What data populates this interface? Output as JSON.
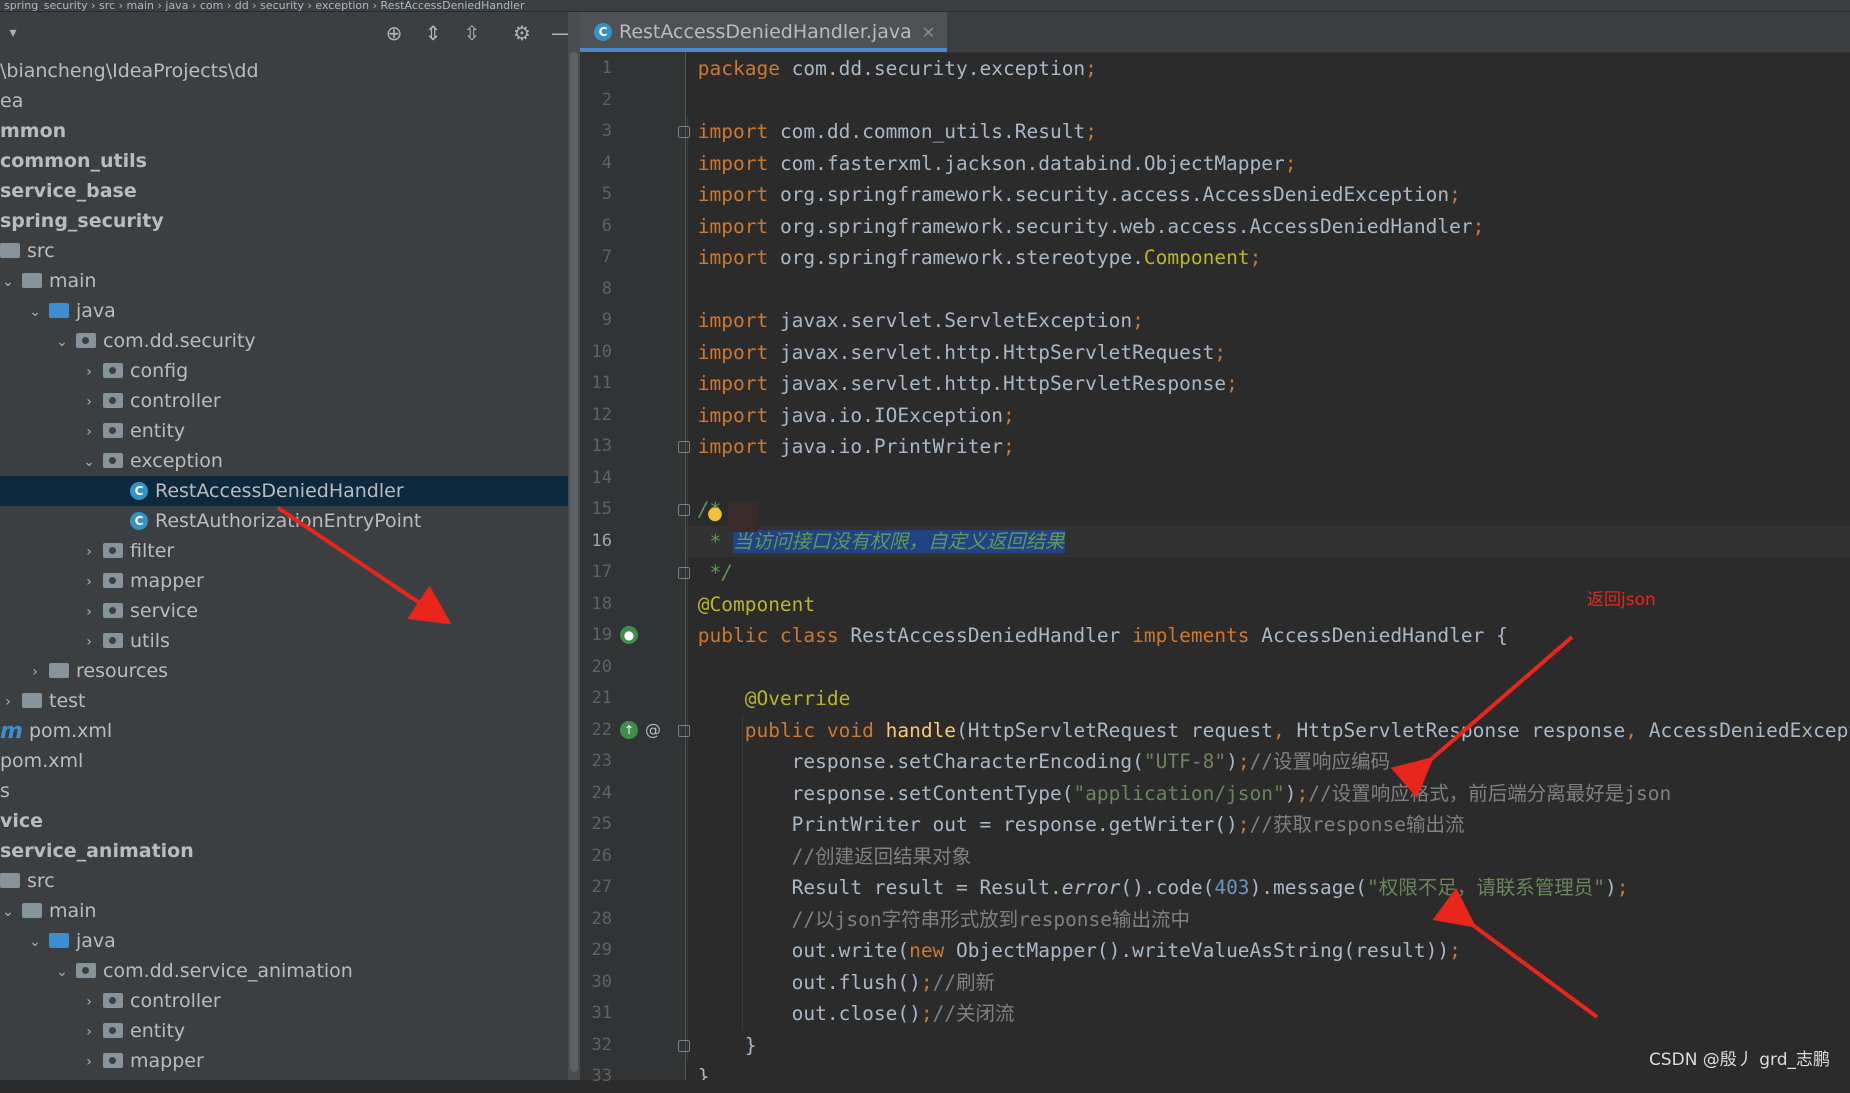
{
  "breadcrumb": "spring_security  ›  src  ›  main  ›  java  ›  com  ›  dd  ›  security  ›  exception  ›  RestAccessDeniedHandler",
  "sidebar": {
    "tree": [
      {
        "label": "\\biancheng\\IdeaProjects\\dd",
        "indent": 0,
        "icon": "none",
        "chev": "none",
        "bold": false,
        "name": "tree-project-path",
        "selected": false
      },
      {
        "label": "ea",
        "indent": 0,
        "icon": "none",
        "chev": "none",
        "bold": false,
        "name": "tree-item-idea",
        "selected": false
      },
      {
        "label": "mmon",
        "indent": 0,
        "icon": "none",
        "chev": "none",
        "bold": true,
        "name": "tree-item-common",
        "selected": false
      },
      {
        "label": "common_utils",
        "indent": 0,
        "icon": "none",
        "chev": "none",
        "bold": true,
        "name": "tree-item-common-utils",
        "selected": false
      },
      {
        "label": "service_base",
        "indent": 0,
        "icon": "none",
        "chev": "none",
        "bold": true,
        "name": "tree-item-service-base",
        "selected": false
      },
      {
        "label": "spring_security",
        "indent": 0,
        "icon": "none",
        "chev": "none",
        "bold": true,
        "name": "tree-item-spring-security",
        "selected": false
      },
      {
        "label": "src",
        "indent": 0,
        "icon": "folder",
        "chev": "none",
        "bold": false,
        "name": "tree-item-src",
        "selected": false
      },
      {
        "label": "main",
        "indent": 1,
        "icon": "folder",
        "chev": "down",
        "bold": false,
        "name": "tree-item-main",
        "selected": false
      },
      {
        "label": "java",
        "indent": 2,
        "icon": "folder-blue",
        "chev": "down",
        "bold": false,
        "name": "tree-item-java",
        "selected": false
      },
      {
        "label": "com.dd.security",
        "indent": 3,
        "icon": "package",
        "chev": "down",
        "bold": false,
        "name": "tree-item-com-dd-security",
        "selected": false
      },
      {
        "label": "config",
        "indent": 4,
        "icon": "package",
        "chev": "right",
        "bold": false,
        "name": "tree-item-config",
        "selected": false
      },
      {
        "label": "controller",
        "indent": 4,
        "icon": "package",
        "chev": "right",
        "bold": false,
        "name": "tree-item-controller",
        "selected": false
      },
      {
        "label": "entity",
        "indent": 4,
        "icon": "package",
        "chev": "right",
        "bold": false,
        "name": "tree-item-entity",
        "selected": false
      },
      {
        "label": "exception",
        "indent": 4,
        "icon": "package",
        "chev": "down",
        "bold": false,
        "name": "tree-item-exception",
        "selected": false
      },
      {
        "label": "RestAccessDeniedHandler",
        "indent": 5,
        "icon": "class",
        "chev": "none",
        "bold": false,
        "name": "tree-item-rest-access-denied-handler",
        "selected": true
      },
      {
        "label": "RestAuthorizationEntryPoint",
        "indent": 5,
        "icon": "class",
        "chev": "none",
        "bold": false,
        "name": "tree-item-rest-authorization-entry-point",
        "selected": false
      },
      {
        "label": "filter",
        "indent": 4,
        "icon": "package",
        "chev": "right",
        "bold": false,
        "name": "tree-item-filter",
        "selected": false
      },
      {
        "label": "mapper",
        "indent": 4,
        "icon": "package",
        "chev": "right",
        "bold": false,
        "name": "tree-item-mapper",
        "selected": false
      },
      {
        "label": "service",
        "indent": 4,
        "icon": "package",
        "chev": "right",
        "bold": false,
        "name": "tree-item-service",
        "selected": false
      },
      {
        "label": "utils",
        "indent": 4,
        "icon": "package",
        "chev": "right",
        "bold": false,
        "name": "tree-item-utils",
        "selected": false
      },
      {
        "label": "resources",
        "indent": 2,
        "icon": "folder",
        "chev": "right",
        "bold": false,
        "name": "tree-item-resources",
        "selected": false
      },
      {
        "label": "test",
        "indent": 1,
        "icon": "folder",
        "chev": "right",
        "bold": false,
        "name": "tree-item-test",
        "selected": false
      },
      {
        "label": "pom.xml",
        "indent": 0,
        "icon": "maven",
        "chev": "none",
        "bold": false,
        "name": "tree-item-pom-xml-module",
        "selected": false
      },
      {
        "label": "pom.xml",
        "indent": 0,
        "icon": "none",
        "chev": "none",
        "bold": false,
        "name": "tree-item-pom-xml",
        "selected": false
      },
      {
        "label": "s",
        "indent": 0,
        "icon": "none",
        "chev": "none",
        "bold": false,
        "name": "tree-item-s",
        "selected": false
      },
      {
        "label": "vice",
        "indent": 0,
        "icon": "none",
        "chev": "none",
        "bold": true,
        "name": "tree-item-service",
        "selected": false
      },
      {
        "label": "service_animation",
        "indent": 0,
        "icon": "none",
        "chev": "none",
        "bold": true,
        "name": "tree-item-service-animation",
        "selected": false
      },
      {
        "label": "src",
        "indent": 0,
        "icon": "folder",
        "chev": "none",
        "bold": false,
        "name": "tree-item-src-2",
        "selected": false
      },
      {
        "label": "main",
        "indent": 1,
        "icon": "folder",
        "chev": "down",
        "bold": false,
        "name": "tree-item-main-2",
        "selected": false
      },
      {
        "label": "java",
        "indent": 2,
        "icon": "folder-blue",
        "chev": "down",
        "bold": false,
        "name": "tree-item-java-2",
        "selected": false
      },
      {
        "label": "com.dd.service_animation",
        "indent": 3,
        "icon": "package",
        "chev": "down",
        "bold": false,
        "name": "tree-item-com-dd-service-animation",
        "selected": false
      },
      {
        "label": "controller",
        "indent": 4,
        "icon": "package",
        "chev": "right",
        "bold": false,
        "name": "tree-item-controller-2",
        "selected": false
      },
      {
        "label": "entity",
        "indent": 4,
        "icon": "package",
        "chev": "right",
        "bold": false,
        "name": "tree-item-entity-2",
        "selected": false
      },
      {
        "label": "mapper",
        "indent": 4,
        "icon": "package",
        "chev": "right",
        "bold": false,
        "name": "tree-item-mapper-2",
        "selected": false
      }
    ]
  },
  "toolbar": {
    "icons": [
      "crosshair-icon",
      "expand-all-icon",
      "collapse-all-icon",
      "gear-icon",
      "minimize-icon"
    ]
  },
  "editor": {
    "tab_label": "RestAccessDeniedHandler.java",
    "current_line": 16,
    "lines": [
      [
        [
          "kw",
          "package "
        ],
        [
          "",
          "com.dd.security.exception"
        ],
        [
          "kw",
          ";"
        ]
      ],
      [],
      [
        [
          "kw",
          "import "
        ],
        [
          "",
          "com.dd.common_utils.Result"
        ],
        [
          "kw",
          ";"
        ]
      ],
      [
        [
          "kw",
          "import "
        ],
        [
          "",
          "com.fasterxml.jackson.databind.ObjectMapper"
        ],
        [
          "kw",
          ";"
        ]
      ],
      [
        [
          "kw",
          "import "
        ],
        [
          "",
          "org.springframework.security.access.AccessDeniedException"
        ],
        [
          "kw",
          ";"
        ]
      ],
      [
        [
          "kw",
          "import "
        ],
        [
          "",
          "org.springframework.security.web.access.AccessDeniedHandler"
        ],
        [
          "kw",
          ";"
        ]
      ],
      [
        [
          "kw",
          "import "
        ],
        [
          "",
          "org.springframework.stereotype."
        ],
        [
          "an",
          "Component"
        ],
        [
          "kw",
          ";"
        ]
      ],
      [],
      [
        [
          "kw",
          "import "
        ],
        [
          "",
          "javax.servlet.ServletException"
        ],
        [
          "kw",
          ";"
        ]
      ],
      [
        [
          "kw",
          "import "
        ],
        [
          "",
          "javax.servlet.http.HttpServletRequest"
        ],
        [
          "kw",
          ";"
        ]
      ],
      [
        [
          "kw",
          "import "
        ],
        [
          "",
          "javax.servlet.http.HttpServletResponse"
        ],
        [
          "kw",
          ";"
        ]
      ],
      [
        [
          "kw",
          "import "
        ],
        [
          "",
          "java.io.IOException"
        ],
        [
          "kw",
          ";"
        ]
      ],
      [
        [
          "kw",
          "import "
        ],
        [
          "",
          "java.io.PrintWriter"
        ],
        [
          "kw",
          ";"
        ]
      ],
      [],
      [
        [
          "doc",
          "/*"
        ]
      ],
      [
        [
          "doc",
          " * "
        ],
        [
          "sel",
          "当访问接口没有权限，自定义返回结果"
        ]
      ],
      [
        [
          "doc",
          " */"
        ]
      ],
      [
        [
          "an",
          "@Component"
        ]
      ],
      [
        [
          "kw",
          "public class "
        ],
        [
          "",
          "RestAccessDeniedHandler "
        ],
        [
          "kw",
          "implements "
        ],
        [
          "",
          "AccessDeniedHandler {"
        ]
      ],
      [],
      [
        [
          "",
          "    "
        ],
        [
          "an",
          "@Override"
        ]
      ],
      [
        [
          "",
          "    "
        ],
        [
          "kw",
          "public void "
        ],
        [
          "fn",
          "handle"
        ],
        [
          "",
          "(HttpServletRequest request"
        ],
        [
          "kw",
          ", "
        ],
        [
          "",
          "HttpServletResponse response"
        ],
        [
          "kw",
          ", "
        ],
        [
          "",
          "AccessDeniedException e)"
        ]
      ],
      [
        [
          "",
          "        response.setCharacterEncoding("
        ],
        [
          "str",
          "\"UTF-8\""
        ],
        [
          "",
          ")"
        ],
        [
          "kw",
          ";"
        ],
        [
          "cm",
          "//设置响应编码"
        ]
      ],
      [
        [
          "",
          "        response.setContentType("
        ],
        [
          "str",
          "\"application/json\""
        ],
        [
          "",
          ")"
        ],
        [
          "kw",
          ";"
        ],
        [
          "cm",
          "//设置响应格式，前后端分离最好是json"
        ]
      ],
      [
        [
          "",
          "        PrintWriter out = response.getWriter()"
        ],
        [
          "kw",
          ";"
        ],
        [
          "cm",
          "//获取response输出流"
        ]
      ],
      [
        [
          "cm",
          "        //创建返回结果对象"
        ]
      ],
      [
        [
          "",
          "        Result result = Result."
        ],
        [
          "it",
          "error"
        ],
        [
          "",
          "().code("
        ],
        [
          "num",
          "403"
        ],
        [
          "",
          ").message("
        ],
        [
          "str",
          "\"权限不足，请联系管理员\""
        ],
        [
          "",
          ")"
        ],
        [
          "kw",
          ";"
        ]
      ],
      [
        [
          "cm",
          "        //以json字符串形式放到response输出流中"
        ]
      ],
      [
        [
          "",
          "        out.write("
        ],
        [
          "kw",
          "new "
        ],
        [
          "",
          "ObjectMapper().writeValueAsString(result))"
        ],
        [
          "kw",
          ";"
        ]
      ],
      [
        [
          "",
          "        out.flush()"
        ],
        [
          "kw",
          ";"
        ],
        [
          "cm",
          "//刷新"
        ]
      ],
      [
        [
          "",
          "        out.close()"
        ],
        [
          "kw",
          ";"
        ],
        [
          "cm",
          "//关闭流"
        ]
      ],
      [
        [
          "",
          "    }"
        ]
      ],
      [
        [
          "",
          "}"
        ]
      ]
    ]
  },
  "annotations": {
    "return_json": "返回json"
  },
  "watermark": "CSDN @殷丿 grd_志鹏"
}
